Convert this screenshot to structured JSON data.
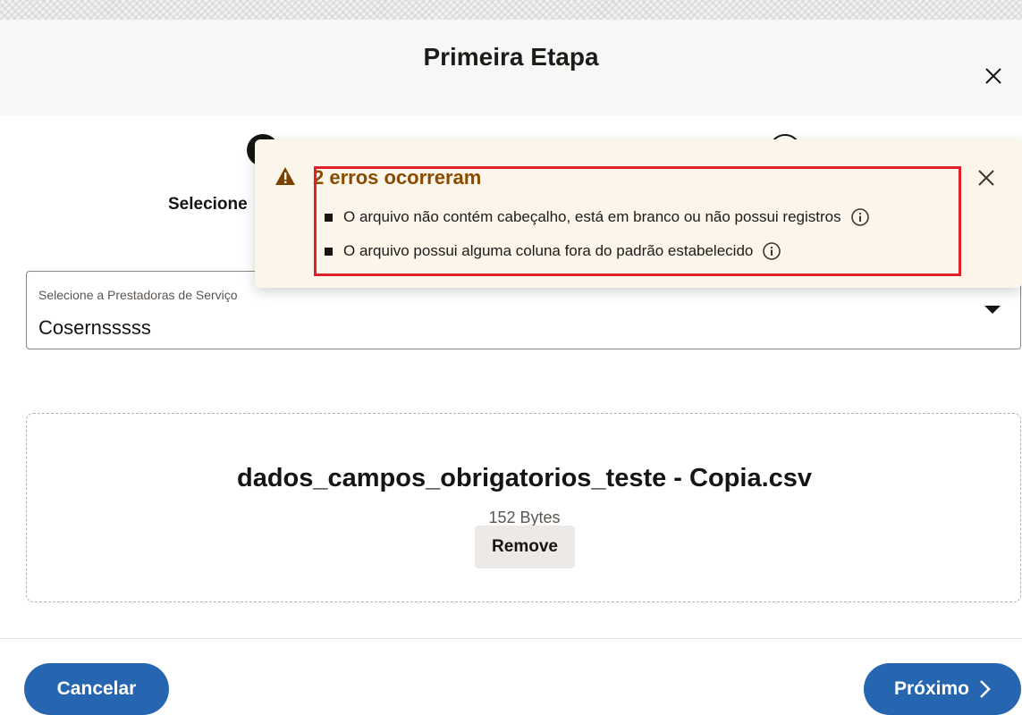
{
  "dialog": {
    "title": "Primeira Etapa",
    "close_icon": "close-icon"
  },
  "stepper": {
    "step1_label": "Selecione"
  },
  "select": {
    "label": "Selecione a Prestadoras de Serviço",
    "value": "Cosernsssss",
    "icon": "caret-down-icon"
  },
  "toast": {
    "title": "2 erros ocorreram",
    "icon": "warning-icon",
    "title_color": "#8a4b00",
    "highlight_color": "#e0202a",
    "errors": [
      {
        "text": "O arquivo não contém cabeçalho, está em branco ou não possui registros",
        "icon": "info-icon"
      },
      {
        "text": "O arquivo possui alguma coluna fora do padrão estabelecido",
        "icon": "info-icon"
      }
    ]
  },
  "upload": {
    "file_name": "dados_campos_obrigatorios_teste - Copia.csv",
    "file_size": "152 Bytes",
    "remove_label": "Remove"
  },
  "footer": {
    "cancel_label": "Cancelar",
    "next_label": "Próximo",
    "accent_color": "#2666b0"
  }
}
